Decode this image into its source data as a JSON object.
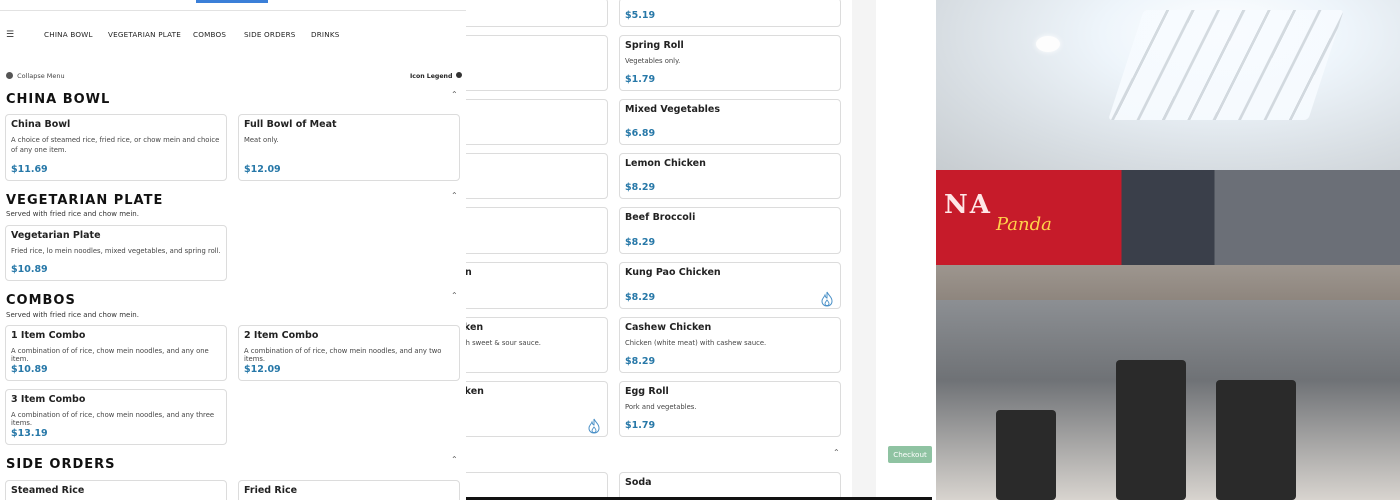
{
  "nav": {
    "items": [
      "CHINA BOWL",
      "VEGETARIAN PLATE",
      "COMBOS",
      "SIDE ORDERS",
      "DRINKS"
    ]
  },
  "menu_controls": {
    "collapse_label": "Collapse Menu",
    "legend_label": "Icon Legend"
  },
  "sections": {
    "china_bowl": {
      "title": "CHINA BOWL",
      "items": [
        {
          "name": "China Bowl",
          "desc": "A choice of steamed rice, fried rice, or chow mein and choice of any one item.",
          "price": "$11.69"
        },
        {
          "name": "Full Bowl of Meat",
          "desc": "Meat only.",
          "price": "$12.09"
        }
      ]
    },
    "vegetarian_plate": {
      "title": "VEGETARIAN PLATE",
      "subtitle": "Served with fried rice and chow mein.",
      "items": [
        {
          "name": "Vegetarian Plate",
          "desc": "Fried rice, lo mein noodles, mixed vegetables, and spring roll.",
          "price": "$10.89"
        }
      ]
    },
    "combos": {
      "title": "COMBOS",
      "subtitle": "Served with fried rice and chow mein.",
      "items": [
        {
          "name": "1 Item Combo",
          "desc": "A combination of of rice, chow mein noodles, and any one item.",
          "price": "$10.89"
        },
        {
          "name": "2 Item Combo",
          "desc": "A combination of of rice, chow mein noodles, and any two items.",
          "price": "$12.09"
        },
        {
          "name": "3 Item Combo",
          "desc": "A combination of of rice, chow mein noodles, and any three items.",
          "price": "$13.19"
        }
      ]
    },
    "side_orders": {
      "title": "SIDE ORDERS",
      "items": [
        {
          "name": "Steamed Rice"
        },
        {
          "name": "Fried Rice"
        }
      ]
    }
  },
  "background_column": {
    "items": [
      {
        "name": "",
        "desc": "",
        "price": "$5.19"
      },
      {
        "name": "Spring Roll",
        "desc": "Vegetables only.",
        "price": "$1.79"
      },
      {
        "name": "Mixed Vegetables",
        "desc": "",
        "price": "$6.89"
      },
      {
        "name": "Lemon Chicken",
        "desc": "",
        "price": "$8.29"
      },
      {
        "name": "Beef Broccoli",
        "desc": "",
        "price": "$8.29"
      },
      {
        "name": "Kung Pao Chicken",
        "desc": "",
        "price": "$8.29"
      },
      {
        "name": "Cashew Chicken",
        "desc": "Chicken (white meat) with cashew sauce.",
        "price": "$8.29"
      },
      {
        "name": "Egg Roll",
        "desc": "Pork and vegetables.",
        "price": "$1.79"
      },
      {
        "name": "Soda",
        "desc": "",
        "price": ""
      }
    ],
    "partial_texts": [
      "n",
      "icken",
      "th sweet & sour sauce.",
      "cken"
    ]
  },
  "checkout_label": "Checkout",
  "photo": {
    "sign_text_1": "NA",
    "sign_text_2": "Panda"
  },
  "colors": {
    "price": "#2778a8",
    "checkout": "#8fc3a2",
    "progress": "#3b7fd8"
  }
}
